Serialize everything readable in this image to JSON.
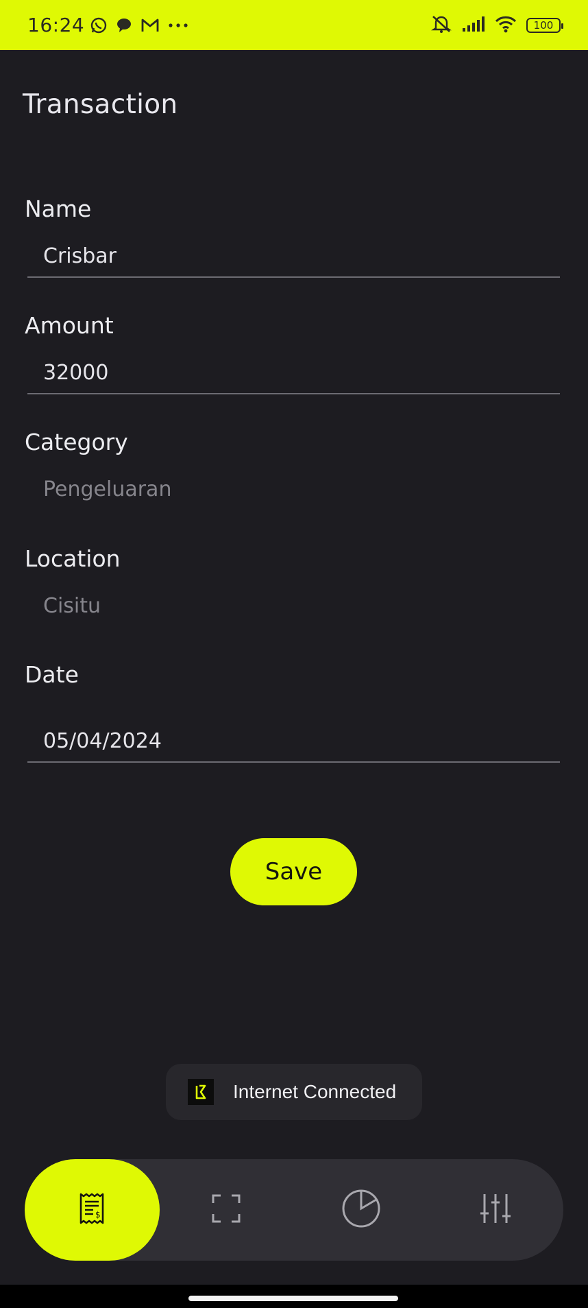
{
  "status_bar": {
    "time": "16:24",
    "battery": "100",
    "background": "#dff904",
    "notification_icons": [
      "whatsapp-icon",
      "chat-bubble-icon",
      "gmail-icon",
      "more-dots-icon"
    ],
    "system_icons": [
      "mute-icon",
      "signal-icon",
      "wifi-icon",
      "battery-icon"
    ]
  },
  "page": {
    "title": "Transaction"
  },
  "form": {
    "name_label": "Name",
    "name_value": "Crisbar",
    "amount_label": "Amount",
    "amount_value": "32000",
    "category_label": "Category",
    "category_value": "Pengeluaran",
    "location_label": "Location",
    "location_value": "Cisitu",
    "date_label": "Date",
    "date_value": "05/04/2024"
  },
  "save_button": {
    "label": "Save"
  },
  "toast": {
    "text": "Internet Connected"
  },
  "bottom_nav": {
    "items": [
      {
        "icon": "receipt-icon",
        "active": true
      },
      {
        "icon": "scan-icon",
        "active": false
      },
      {
        "icon": "pie-chart-icon",
        "active": false
      },
      {
        "icon": "settings-sliders-icon",
        "active": false
      }
    ]
  },
  "colors": {
    "accent": "#dff904",
    "background": "#1d1c21",
    "nav_background": "#302f35",
    "muted_text": "#86858c"
  }
}
